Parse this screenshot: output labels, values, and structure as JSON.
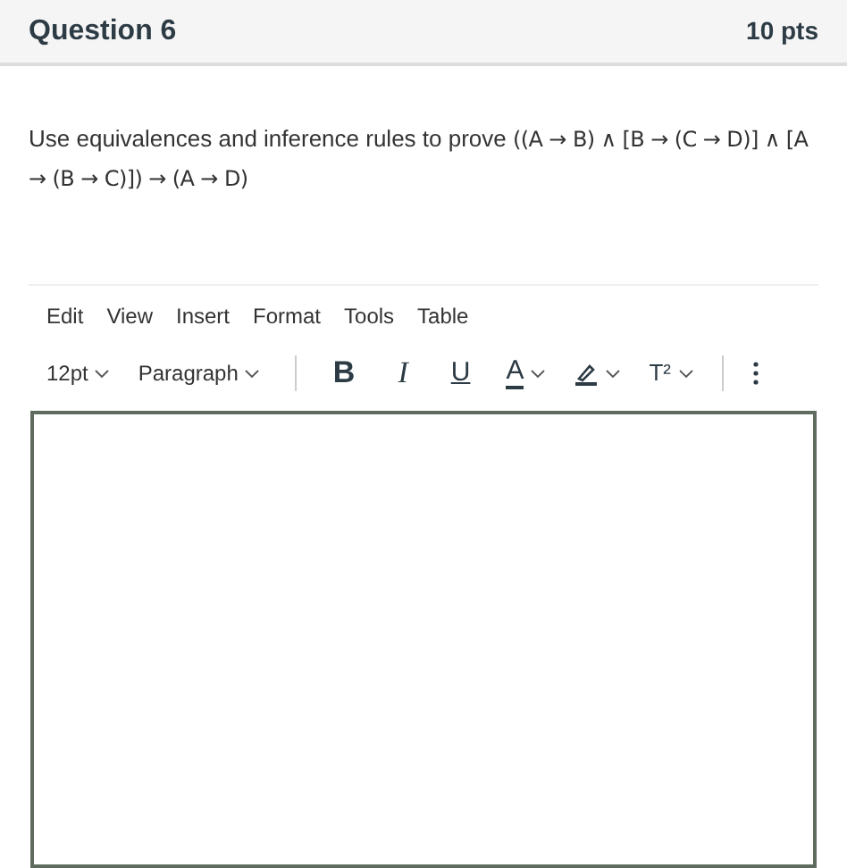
{
  "header": {
    "title": "Question 6",
    "points": "10 pts"
  },
  "question": {
    "prompt": "Use equivalences and inference rules to prove ",
    "formula": "((A → B) ∧ [B → (C → D)] ∧ [A → (B → C)]) → (A → D)"
  },
  "editor": {
    "menu": [
      "Edit",
      "View",
      "Insert",
      "Format",
      "Tools",
      "Table"
    ],
    "toolbar": [
      {
        "kind": "dropdown",
        "label": "12pt"
      },
      {
        "kind": "dropdown",
        "label": "Paragraph"
      },
      {
        "kind": "separator"
      },
      {
        "kind": "bold",
        "label": "B"
      },
      {
        "kind": "italic",
        "label": "I"
      },
      {
        "kind": "underline",
        "label": "U"
      },
      {
        "kind": "font-color",
        "label": "A"
      },
      {
        "kind": "highlight"
      },
      {
        "kind": "superscript",
        "label": "T²"
      },
      {
        "kind": "separator"
      },
      {
        "kind": "more"
      }
    ]
  }
}
